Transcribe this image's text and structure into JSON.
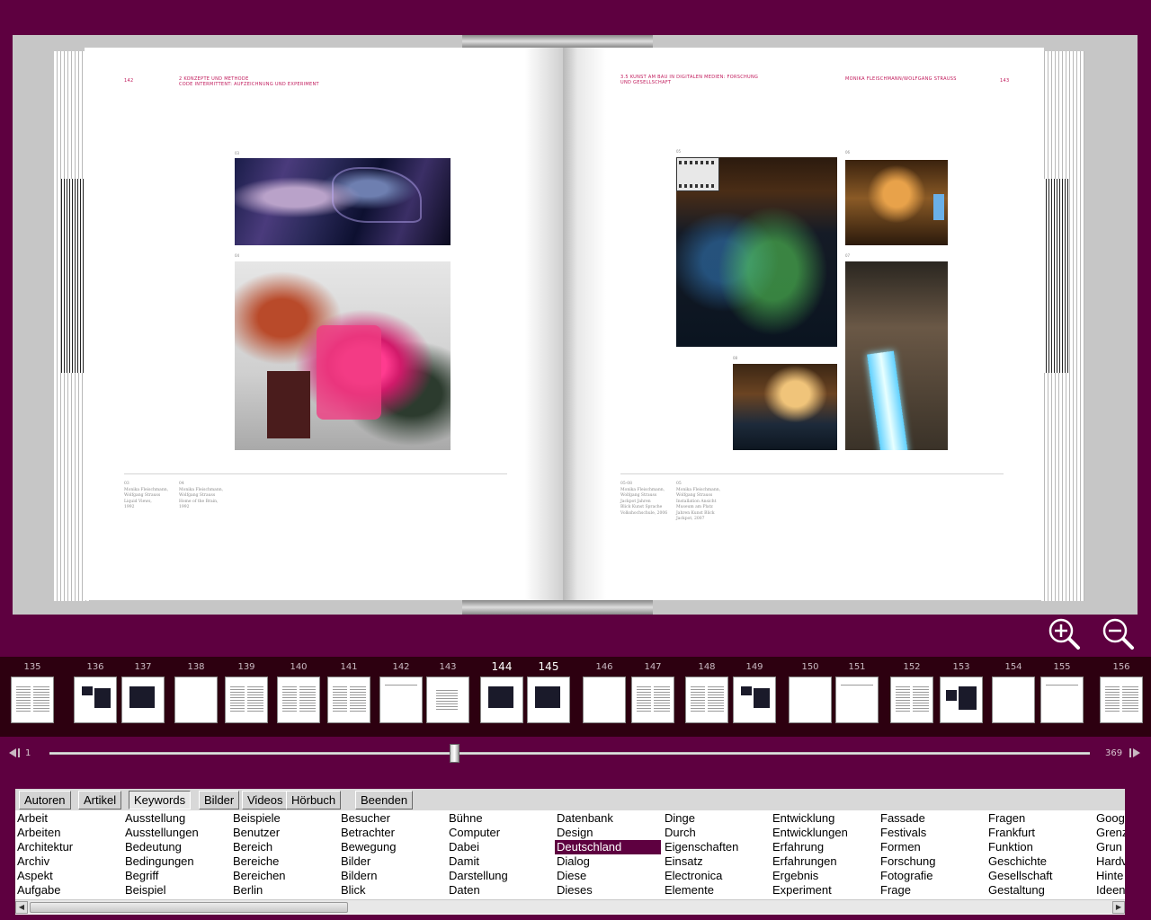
{
  "viewer": {
    "left_page": {
      "runhead_num": "142",
      "runhead_chapter": "2  KONZEPTE UND METHODE",
      "runhead_sub": "CODE INTERMITTENT: AUFZEICHNUNG UND EXPERIMENT",
      "fig1_no": "03",
      "fig2_no": "04",
      "caption_a": "03\nMonika Fleischmann,\nWolfgang Strauss\nLiquid Views,\n1992",
      "caption_b": "04\nMonika Fleischmann,\nWolfgang Strauss\nHome of the Brain,\n1992"
    },
    "right_page": {
      "runhead_title": "3.5 KUNST AM BAU IN DIGITALEN MEDIEN: FORSCHUNG",
      "runhead_title2": "UND GESELLSCHAFT",
      "runhead_authors": "MONIKA FLEISCHMANN/WOLFGANG STRAUSS",
      "runhead_num": "143",
      "fig1_no": "05",
      "fig2_no": "06",
      "fig3_no": "07",
      "fig4_no": "08",
      "caption_a": "05-08\nMonika Fleischmann,\nWolfgang Strauss\nJackpot Jahren\nBlick Kunst Sprache\nVolkshochschule, 2006",
      "caption_b": "05\nMonika Fleischmann,\nWolfgang Strauss\nInstallation Ansicht\nMuseum am Platz\nJahren Kunst Blick\nJackpot, 2007"
    }
  },
  "zoom": {
    "in_label": "zoom in",
    "out_label": "zoom out"
  },
  "thumbnails": [
    {
      "num": "135",
      "current": false
    },
    {
      "num": "136",
      "current": false
    },
    {
      "num": "137",
      "current": false
    },
    {
      "num": "138",
      "current": false
    },
    {
      "num": "139",
      "current": false
    },
    {
      "num": "140",
      "current": false
    },
    {
      "num": "141",
      "current": false
    },
    {
      "num": "142",
      "current": false
    },
    {
      "num": "143",
      "current": false
    },
    {
      "num": "144",
      "current": true
    },
    {
      "num": "145",
      "current": true
    },
    {
      "num": "146",
      "current": false
    },
    {
      "num": "147",
      "current": false
    },
    {
      "num": "148",
      "current": false
    },
    {
      "num": "149",
      "current": false
    },
    {
      "num": "150",
      "current": false
    },
    {
      "num": "151",
      "current": false
    },
    {
      "num": "152",
      "current": false
    },
    {
      "num": "153",
      "current": false
    },
    {
      "num": "154",
      "current": false
    },
    {
      "num": "155",
      "current": false
    },
    {
      "num": "156",
      "current": false
    }
  ],
  "slider": {
    "min_label": "1",
    "max_label": "369",
    "position_fraction": 0.39
  },
  "tabs": [
    "Autoren",
    "Artikel",
    "Keywords",
    "Bilder",
    "Videos",
    "Hörbuch",
    "Beenden"
  ],
  "active_tab": "Keywords",
  "keywords": [
    [
      "Arbeit",
      "Arbeiten",
      "Architektur",
      "Archiv",
      "Aspekt",
      "Aufgabe"
    ],
    [
      "Ausstellung",
      "Ausstellungen",
      "Bedeutung",
      "Bedingungen",
      "Begriff",
      "Beispiel"
    ],
    [
      "Beispiele",
      "Benutzer",
      "Bereich",
      "Bereiche",
      "Bereichen",
      "Berlin"
    ],
    [
      "Besucher",
      "Betrachter",
      "Bewegung",
      "Bilder",
      "Bildern",
      "Blick"
    ],
    [
      "Bühne",
      "Computer",
      "Dabei",
      "Damit",
      "Darstellung",
      "Daten"
    ],
    [
      "Datenbank",
      "Design",
      "Deutschland",
      "Dialog",
      "Diese",
      "Dieses"
    ],
    [
      "Dinge",
      "Durch",
      "Eigenschaften",
      "Einsatz",
      "Electronica",
      "Elemente"
    ],
    [
      "Entwicklung",
      "Entwicklungen",
      "Erfahrung",
      "Erfahrungen",
      "Ergebnis",
      "Experiment"
    ],
    [
      "Fassade",
      "Festivals",
      "Formen",
      "Forschung",
      "Fotografie",
      "Frage"
    ],
    [
      "Fragen",
      "Frankfurt",
      "Funktion",
      "Geschichte",
      "Gesellschaft",
      "Gestaltung"
    ],
    [
      "Goog",
      "Grenz",
      "Grun",
      "Hardv",
      "Hinte",
      "Ideen"
    ]
  ],
  "selected_keyword": "Deutschland",
  "colors": {
    "background": "#5e0040",
    "strip": "#2d0010",
    "selection": "#5e0040"
  }
}
